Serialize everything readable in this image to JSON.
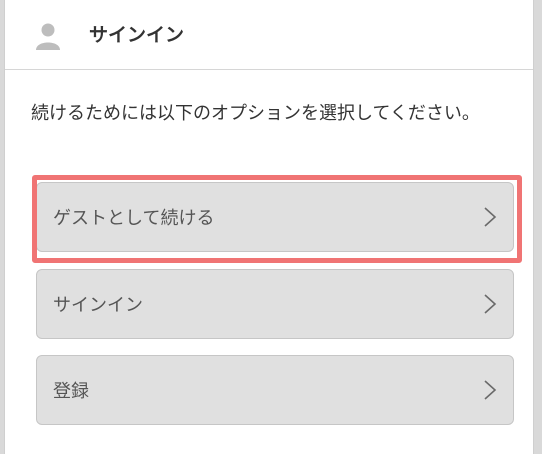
{
  "dialog": {
    "title": "サインイン",
    "user_icon": "user-icon",
    "instruction": "続けるためには以下のオプションを選択してください。",
    "highlight_color": "#f07474",
    "options": [
      {
        "label": "ゲストとして続ける",
        "icon": "chevron-right-icon"
      },
      {
        "label": "サインイン",
        "icon": "chevron-right-icon"
      },
      {
        "label": "登録",
        "icon": "chevron-right-icon"
      }
    ]
  }
}
